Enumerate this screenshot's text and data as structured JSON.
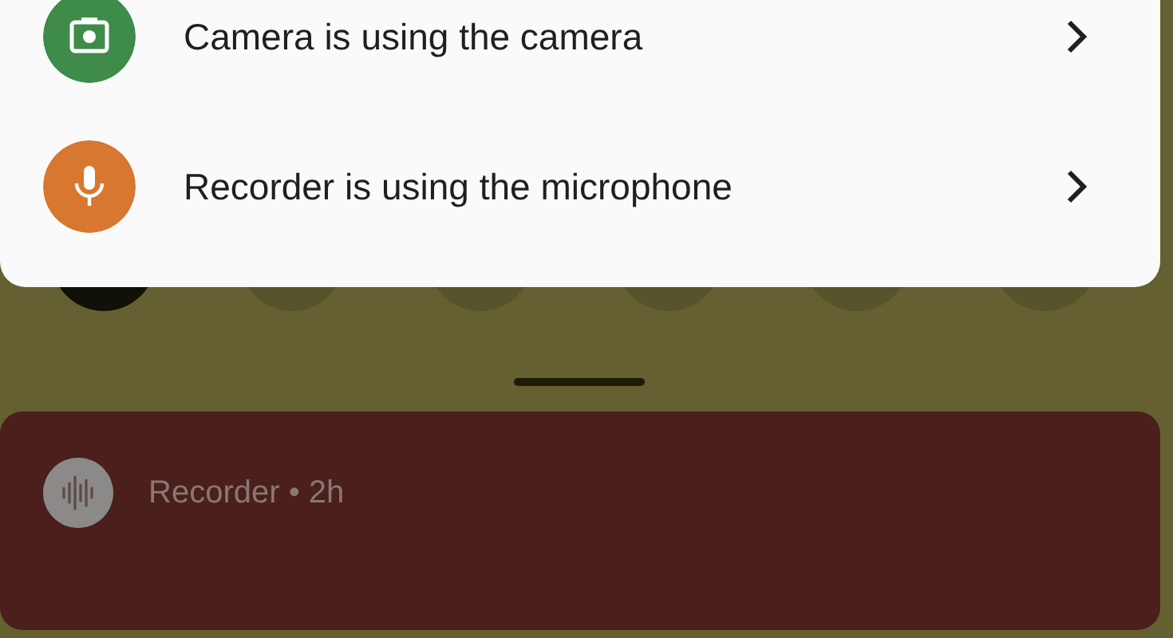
{
  "privacy_items": [
    {
      "kind": "camera",
      "label": "Camera is using the camera",
      "color": "#3f8b4a"
    },
    {
      "kind": "microphone",
      "label": "Recorder is using the microphone",
      "color": "#d8772f"
    }
  ],
  "quick_tiles": [
    {
      "on": true
    },
    {
      "on": false
    },
    {
      "on": false
    },
    {
      "on": false
    },
    {
      "on": false
    },
    {
      "on": false
    }
  ],
  "notification": {
    "app": "Recorder",
    "separator": "•",
    "time": "2h"
  }
}
